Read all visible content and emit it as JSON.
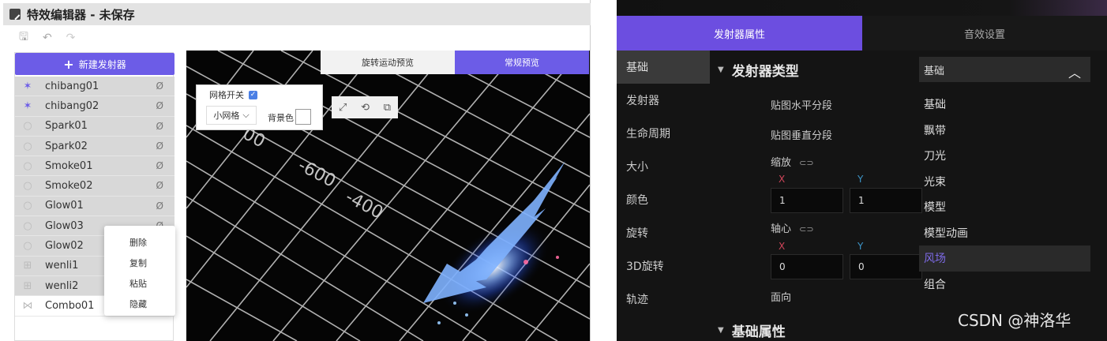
{
  "editor": {
    "title": "特效编辑器 - 未保存",
    "toolbar": {
      "save": "🖫",
      "undo": "↶",
      "redo": "↷"
    },
    "new_emitter": "新建发射器",
    "emitters": [
      {
        "name": "chibang01",
        "icon": "sparkle-icon",
        "glyph": "✶"
      },
      {
        "name": "chibang02",
        "icon": "sparkle-icon",
        "glyph": "✶"
      },
      {
        "name": "Spark01",
        "icon": "circle-icon",
        "glyph": "○"
      },
      {
        "name": "Spark02",
        "icon": "circle-icon",
        "glyph": "○"
      },
      {
        "name": "Smoke01",
        "icon": "circle-icon",
        "glyph": "○"
      },
      {
        "name": "Smoke02",
        "icon": "circle-icon",
        "glyph": "○"
      },
      {
        "name": "Glow01",
        "icon": "circle-icon",
        "glyph": "○"
      },
      {
        "name": "Glow03",
        "icon": "circle-icon",
        "glyph": "○"
      },
      {
        "name": "Glow02",
        "icon": "circle-icon",
        "glyph": "○"
      },
      {
        "name": "wenli1",
        "icon": "texture-icon",
        "glyph": "⊞"
      },
      {
        "name": "wenli2",
        "icon": "texture-icon",
        "glyph": "⊞"
      },
      {
        "name": "Combo01",
        "icon": "combo-icon",
        "glyph": "⋈"
      }
    ],
    "context_menu": [
      "删除",
      "复制",
      "粘贴",
      "隐藏"
    ],
    "view_tabs": {
      "rotate_preview": "旋转运动预览",
      "normal_preview": "常规预览"
    },
    "grid": {
      "toggle_label": "网格开关",
      "size": "小网格",
      "bg_label": "背景色"
    },
    "grid_numbers": [
      "-600",
      "-400",
      "00"
    ]
  },
  "props": {
    "tabs": {
      "emitter": "发射器属性",
      "sound": "音效设置"
    },
    "nav": [
      "基础",
      "发射器",
      "生命周期",
      "大小",
      "颜色",
      "旋转",
      "3D旋转",
      "轨迹"
    ],
    "section_type": "发射器类型",
    "fields": {
      "h_seg": "贴图水平分段",
      "v_seg": "贴图垂直分段",
      "scale": "缩放",
      "pivot": "轴心",
      "facing": "面向",
      "link": "⊂⊃"
    },
    "scale": {
      "x_label": "X",
      "y_label": "Y",
      "x": "1",
      "y": "1"
    },
    "pivot": {
      "x_label": "X",
      "y_label": "Y",
      "x": "0",
      "y": "0"
    },
    "section_basic": "基础属性",
    "type_select": {
      "value": "基础",
      "options": [
        "基础",
        "飘带",
        "刀光",
        "光束",
        "模型",
        "模型动画",
        "风场",
        "组合"
      ],
      "highlighted": "风场"
    }
  },
  "watermark": "CSDN @神洛华",
  "colors": {
    "accent": "#6c5ce7",
    "accent_dark": "#6c4ee0",
    "highlight_text": "#7d6ae6"
  }
}
